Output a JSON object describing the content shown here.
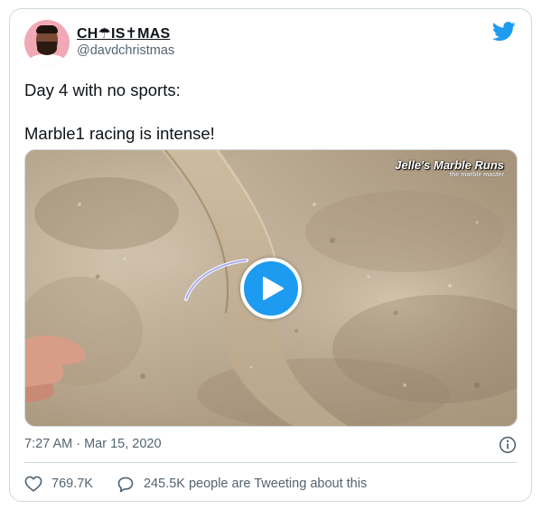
{
  "author": {
    "display_name": "CH☂IS✝MAS",
    "handle": "@davdchristmas"
  },
  "tweet": {
    "line1": "Day 4 with no sports:",
    "line2": "Marble1 racing is intense!"
  },
  "media": {
    "watermark_title": "Jelle's Marble Runs",
    "watermark_subtitle": "the marble master",
    "play_icon": "play-icon",
    "accent_color": "#1d9bf0"
  },
  "meta": {
    "timestamp": "7:27 AM · Mar 15, 2020"
  },
  "actions": {
    "likes": "769.7K",
    "tweeting": "245.5K people are Tweeting about this"
  },
  "colors": {
    "brand": "#1d9bf0",
    "text": "#0f1419",
    "secondary": "#536471",
    "border": "#cfd9de"
  }
}
